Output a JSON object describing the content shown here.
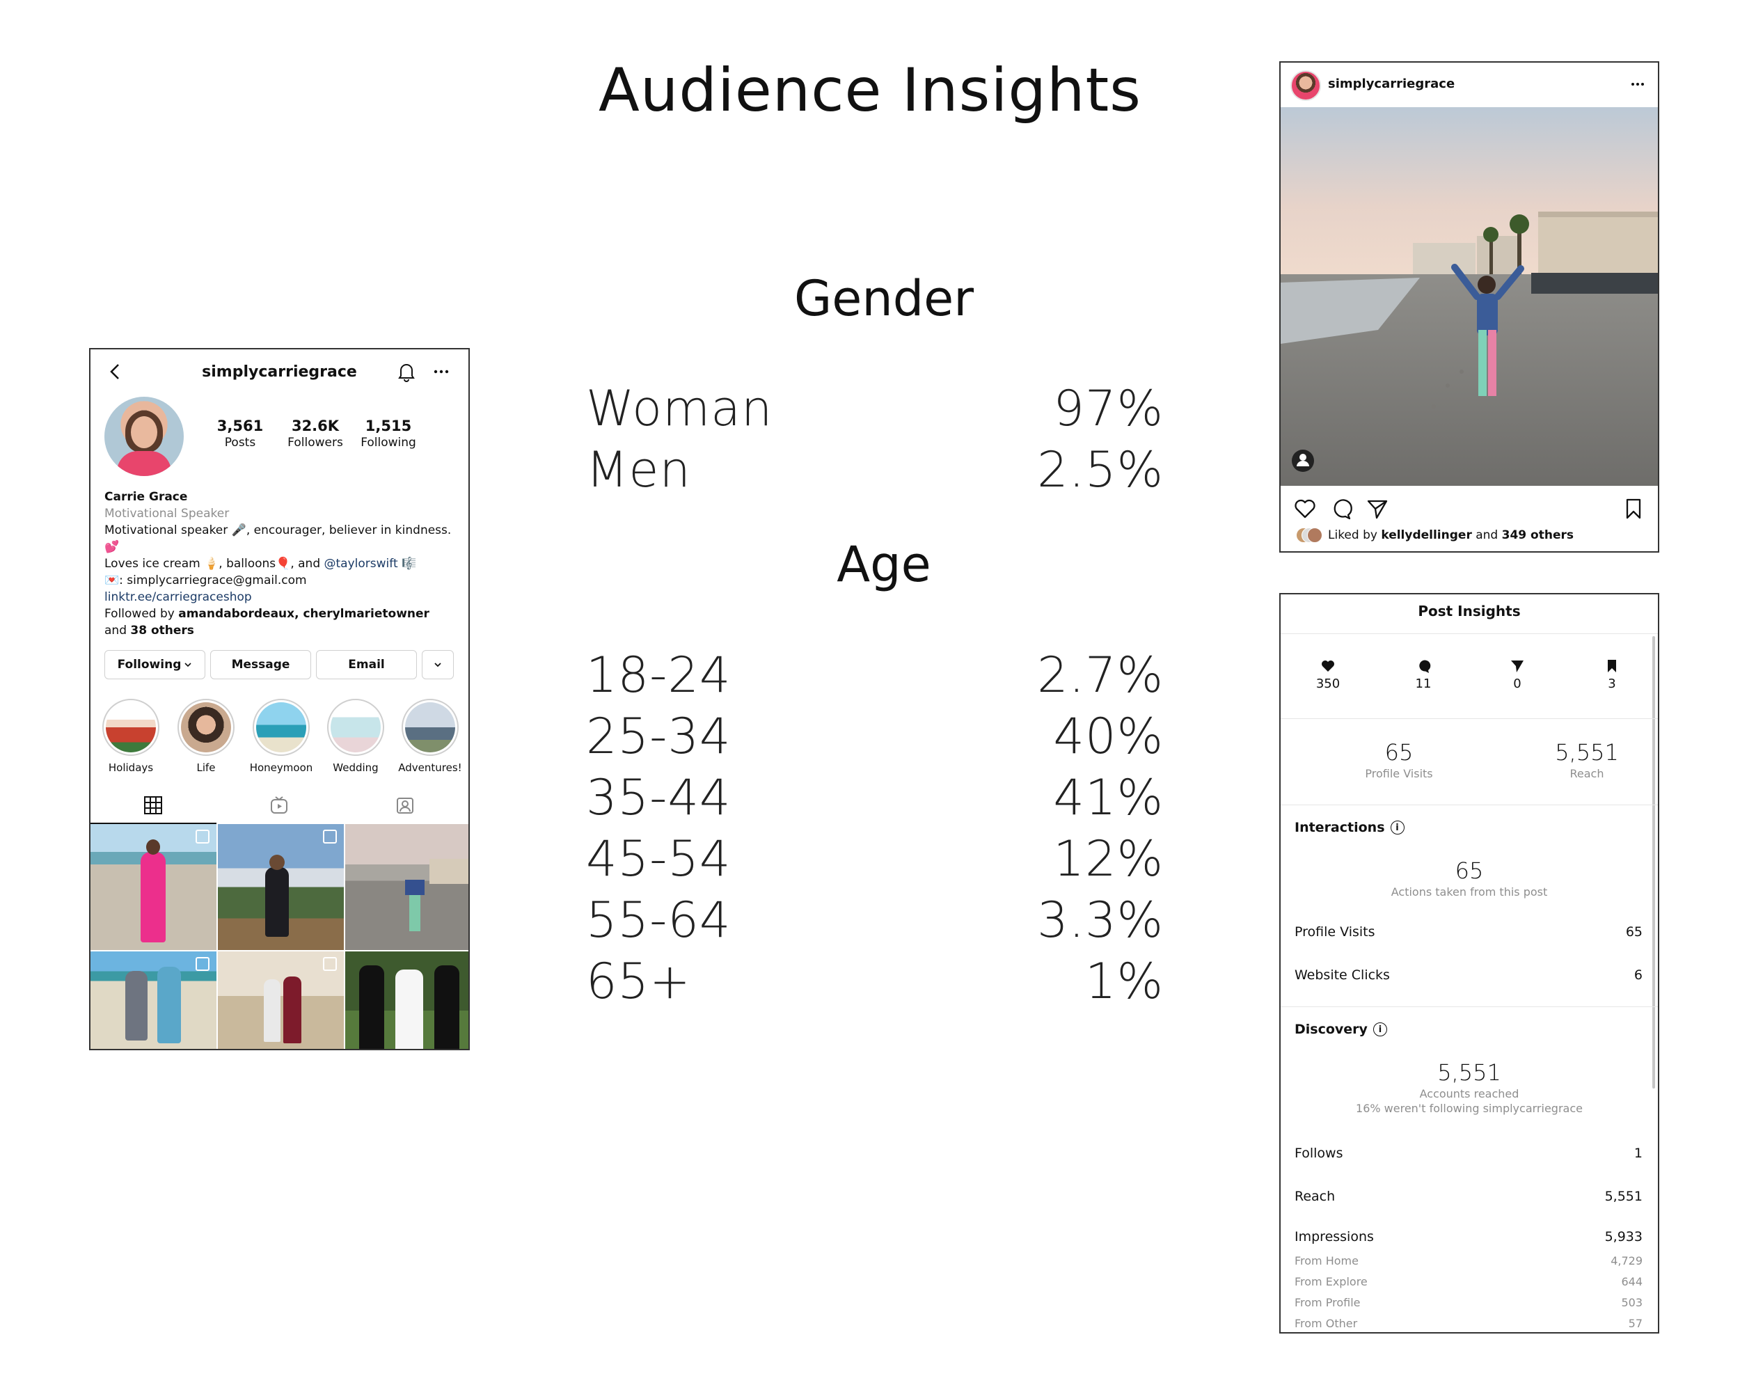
{
  "page": {
    "title": "Audience Insights",
    "gender_heading": "Gender",
    "age_heading": "Age",
    "gender": [
      {
        "label": "Woman",
        "value": "97%"
      },
      {
        "label": "Men",
        "value": "2.5%"
      }
    ],
    "age": [
      {
        "label": "18-24",
        "value": "2.7%"
      },
      {
        "label": "25-34",
        "value": "40%"
      },
      {
        "label": "35-44",
        "value": "41%"
      },
      {
        "label": "45-54",
        "value": "12%"
      },
      {
        "label": "55-64",
        "value": "3.3%"
      },
      {
        "label": "65+",
        "value": "1%"
      }
    ]
  },
  "profile": {
    "username": "simplycarriegrace",
    "stats": [
      {
        "num": "3,561",
        "label": "Posts"
      },
      {
        "num": "32.6K",
        "label": "Followers"
      },
      {
        "num": "1,515",
        "label": "Following"
      }
    ],
    "name": "Carrie Grace",
    "category": "Motivational Speaker",
    "bio_line1": "Motivational speaker 🎤, encourager, believer in kindness.",
    "bio_line2": "💕",
    "bio_line3a": "Loves ice cream 🍦, balloons🎈, and ",
    "bio_line3b": "@taylorswift",
    "bio_line3c": " 🎼",
    "bio_line4": "💌: simplycarriegrace@gmail.com",
    "link": "linktr.ee/carriegraceshop",
    "followed_prefix": "Followed by ",
    "followed_names": "amandabordeaux, cherylmarietowner",
    "followed_and": "and ",
    "followed_others": "38 others",
    "buttons": {
      "following": "Following",
      "message": "Message",
      "email": "Email"
    },
    "highlights": [
      "Holidays",
      "Life",
      "Honeymoon",
      "Wedding",
      "Adventures!"
    ]
  },
  "post": {
    "username": "simplycarriegrace",
    "liked_prefix": "Liked by ",
    "liked_user": "kellydellinger",
    "liked_mid": " and ",
    "liked_others": "349 others"
  },
  "insights": {
    "title": "Post Insights",
    "engagement": {
      "likes": "350",
      "comments": "11",
      "shares": "0",
      "saves": "3"
    },
    "profile_visits_big": {
      "num": "65",
      "label": "Profile Visits"
    },
    "reach_big": {
      "num": "5,551",
      "label": "Reach"
    },
    "interactions_heading": "Interactions",
    "interactions_total": "65",
    "interactions_caption": "Actions taken from this post",
    "profile_visits": {
      "label": "Profile Visits",
      "value": "65"
    },
    "website_clicks": {
      "label": "Website Clicks",
      "value": "6"
    },
    "discovery_heading": "Discovery",
    "accounts_reached": "5,551",
    "accounts_reached_label": "Accounts reached",
    "not_following": "16% weren't following simplycarriegrace",
    "follows": {
      "label": "Follows",
      "value": "1"
    },
    "reach": {
      "label": "Reach",
      "value": "5,551"
    },
    "impressions": {
      "label": "Impressions",
      "value": "5,933"
    },
    "impression_sources": [
      {
        "label": "From Home",
        "value": "4,729"
      },
      {
        "label": "From Explore",
        "value": "644"
      },
      {
        "label": "From Profile",
        "value": "503"
      },
      {
        "label": "From Other",
        "value": "57"
      }
    ]
  }
}
